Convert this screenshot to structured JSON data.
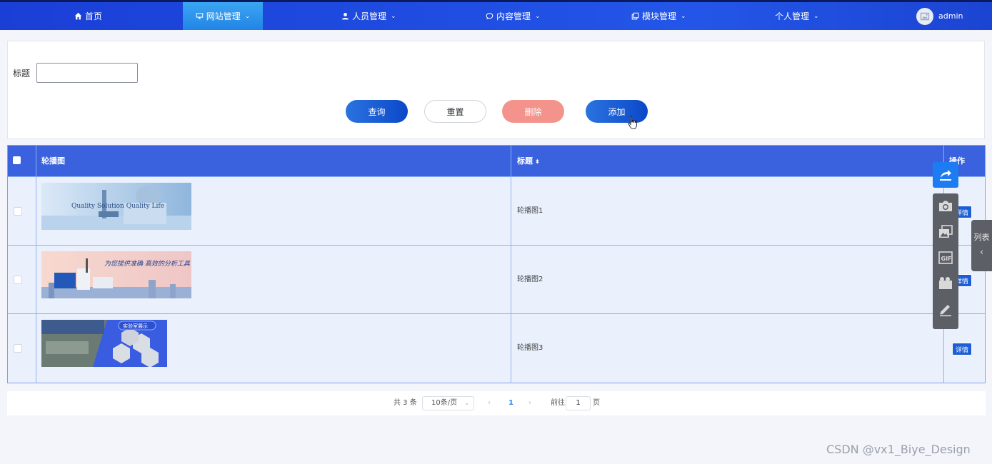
{
  "nav": {
    "items": [
      {
        "label": "首页",
        "icon": "home-icon"
      },
      {
        "label": "网站管理",
        "icon": "monitor-icon",
        "active": true
      },
      {
        "label": "人员管理",
        "icon": "user-icon"
      },
      {
        "label": "内容管理",
        "icon": "chat-icon"
      },
      {
        "label": "模块管理",
        "icon": "copy-icon"
      },
      {
        "label": "个人管理",
        "icon": ""
      }
    ],
    "user": "admin"
  },
  "search": {
    "title_label": "标题",
    "title_value": ""
  },
  "buttons": {
    "query": "查询",
    "reset": "重置",
    "delete": "删除",
    "add": "添加"
  },
  "table": {
    "columns": [
      "轮播图",
      "标题",
      "操作"
    ],
    "rows": [
      {
        "image_text": "Quality Solution  Quality Life",
        "title": "轮播图1",
        "action": "详情"
      },
      {
        "image_text": "为您提供准确 高效的分析工具",
        "title": "轮播图2",
        "action": "详情"
      },
      {
        "image_text": "实验室展示",
        "title": "轮播图3",
        "action": "详情"
      }
    ]
  },
  "pagination": {
    "total": "共 3 条",
    "page_size": "10条/页",
    "current": "1",
    "goto_prefix": "前往",
    "goto_value": "1",
    "goto_suffix": "页"
  },
  "overlay": {
    "side_tab": "列表"
  },
  "watermark": "CSDN @vx1_Biye_Design",
  "colors": {
    "nav_bg": "#1f4be0",
    "active_tab": "#2a8ae8",
    "primary": "#1550d0",
    "danger": "#f4938b",
    "table_header": "#3a62de"
  }
}
